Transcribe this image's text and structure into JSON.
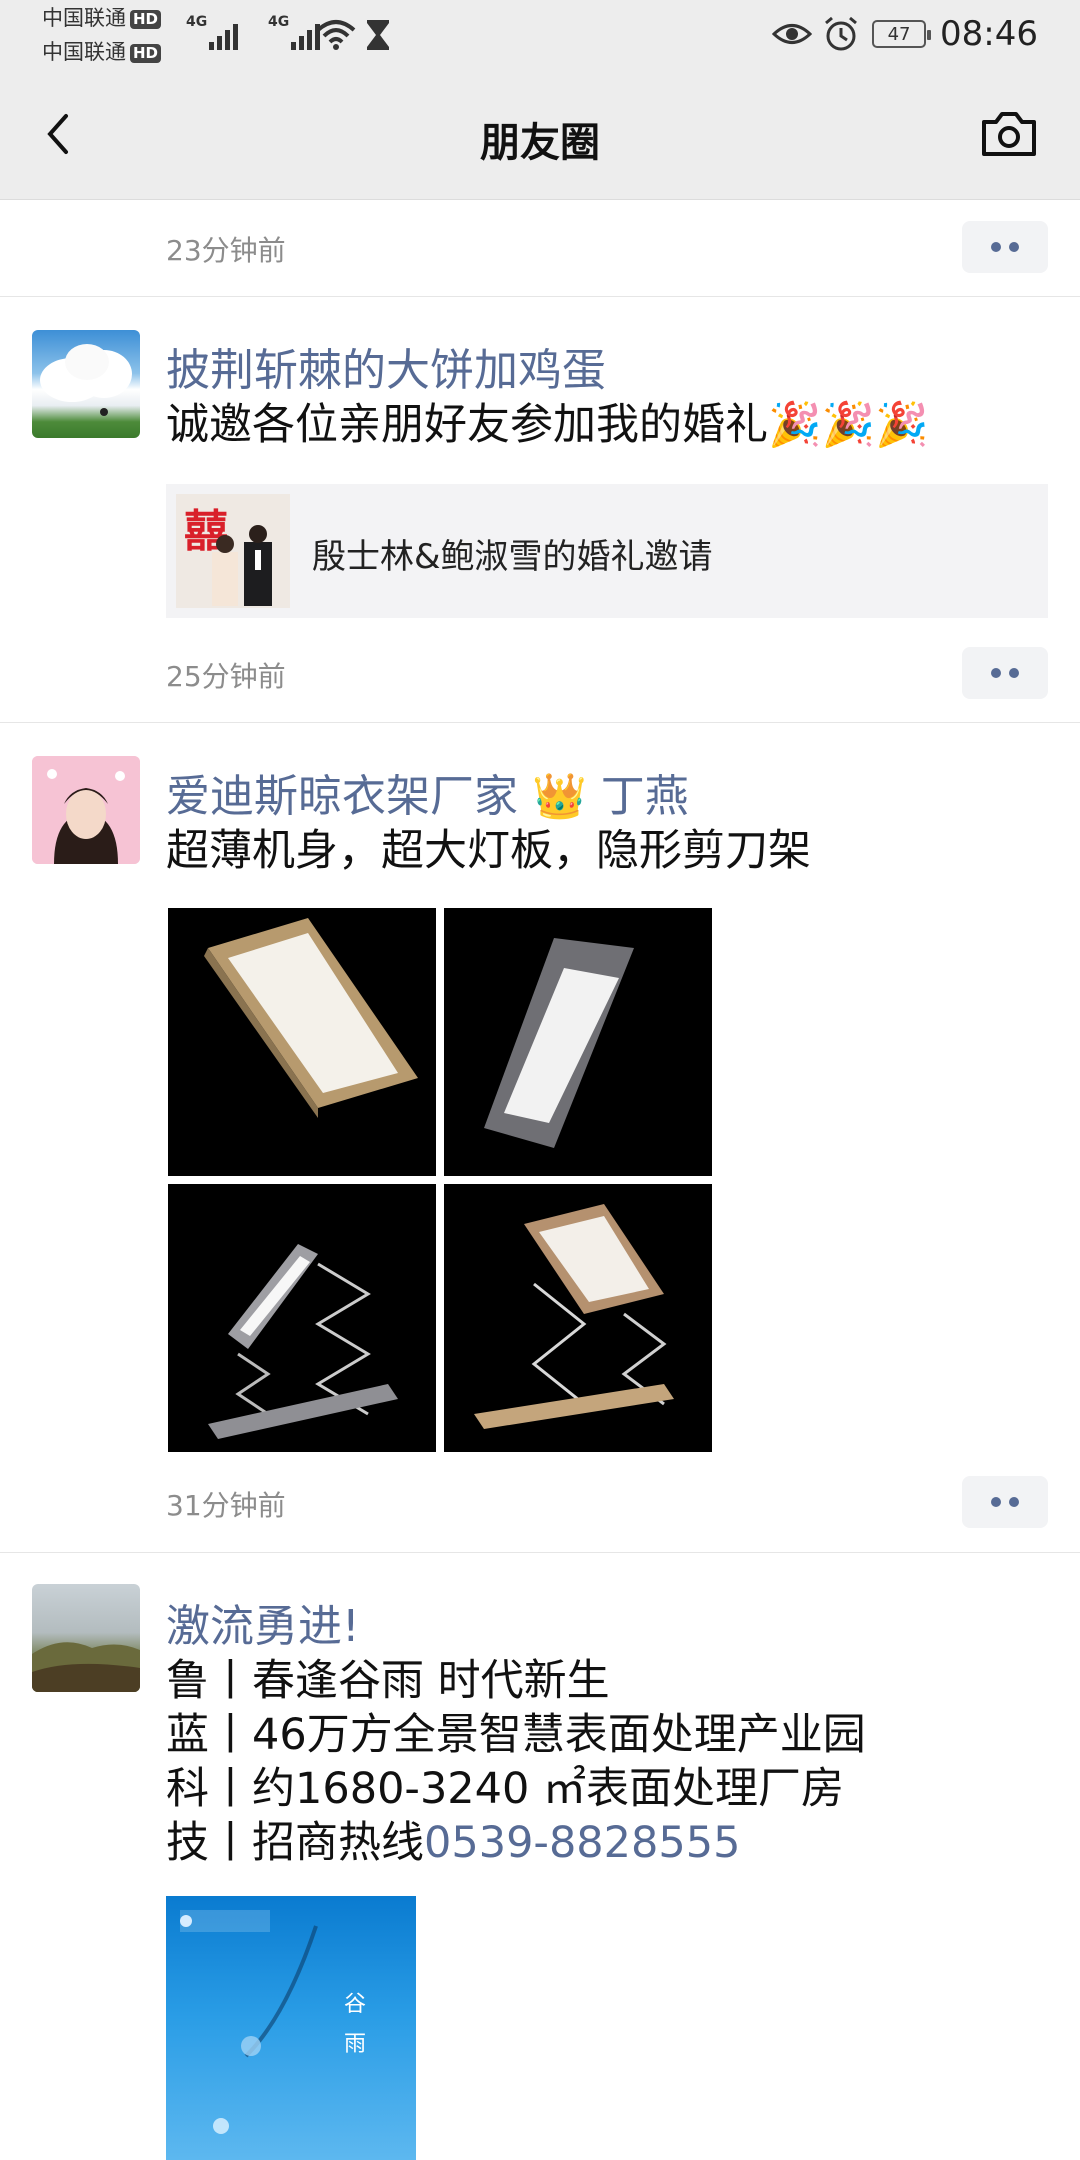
{
  "status": {
    "carrier1": "中国联通",
    "carrier2": "中国联通",
    "hd": "HD",
    "net": "4G",
    "battery": "47",
    "time": "08:46"
  },
  "nav": {
    "title": "朋友圈",
    "back_icon": "chevron-left-icon",
    "camera_icon": "camera-icon"
  },
  "accent_color": "#576b95",
  "posts": [
    {
      "time": "23分钟前"
    },
    {
      "author": "披荆斩棘的大饼加鸡蛋",
      "text": "诚邀各位亲朋好友参加我的婚礼🎉🎉🎉",
      "share_title": "殷士林&鲍淑雪的婚礼邀请",
      "time": "25分钟前"
    },
    {
      "author": "爱迪斯晾衣架厂家 👑 丁燕",
      "text": "超薄机身，超大灯板，隐形剪刀架",
      "time": "31分钟前"
    },
    {
      "author": "激流勇进!",
      "lines": [
        "鲁丨春逢谷雨 时代新生",
        "蓝丨46万方全景智慧表面处理产业园",
        "科丨约1680-3240 ㎡表面处理厂房",
        "技丨招商热线"
      ],
      "phone": "0539-8828555",
      "poster_text": "谷雨"
    }
  ]
}
